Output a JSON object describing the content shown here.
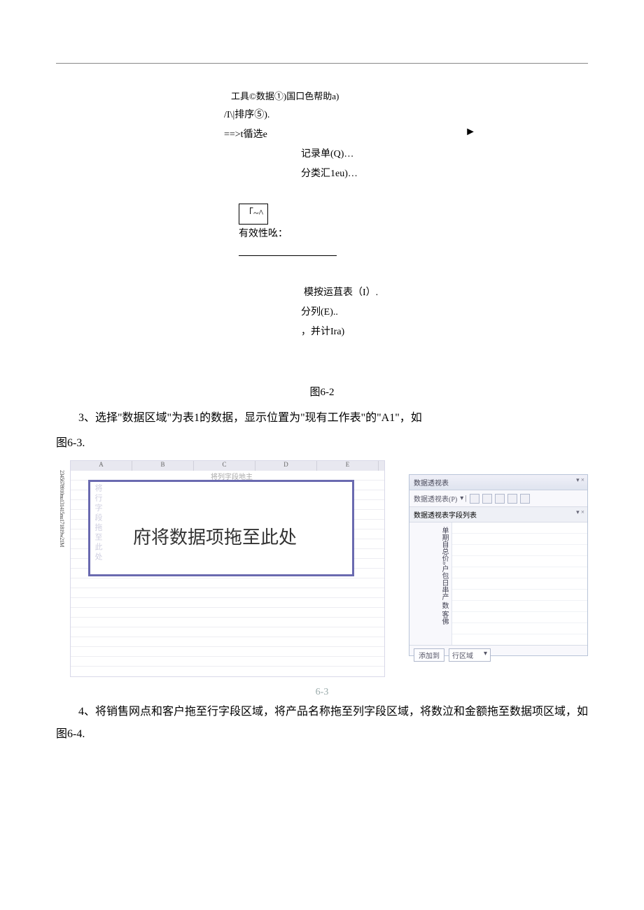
{
  "menu": {
    "title": "工具©数据①)国口色帮助a)",
    "sort": "/I\\|排序⑤).",
    "filter": "==>t循选e",
    "arrow": "►",
    "record": "记录单(Q)…",
    "subtotal": "分类汇1eu)…",
    "boxed": "「~^",
    "validity": "有效性吆：",
    "simtable": "模按运苴表（I）.",
    "texttocol": "分列(E)..",
    "calc": "，并计Ira)"
  },
  "captions": {
    "fig62": "图6-2",
    "fig63": "6-3"
  },
  "paragraphs": {
    "p3a": "3、选择\"数据区域\"为表1的数据，显示位置为\"现有工作表\"的\"A1\"，如",
    "p3b": "图6-3.",
    "p4": "4、将销售网点和客户拖至行字段区域，将产品名称拖至列字段区域，将数泣和金额拖至数据项区域，如图6-4."
  },
  "excel": {
    "cols": [
      "A",
      "B",
      "C",
      "D",
      "E"
    ],
    "drop_col": "将列字段地主",
    "row_nums": "2345678910nu131415nu171819w21M",
    "row_field_ghost": "将行字段拖至此处",
    "center": "府将数据项拖至此处"
  },
  "panel": {
    "title1": "数据透视表",
    "title2": "数据透视表(P)",
    "title3": "数据透视表字段列表",
    "vx": "▾ ×",
    "fields": "单期自总价»户包日串产\n数    客佛",
    "add_button": "添加到",
    "select_label": "行区域",
    "chev": "▾"
  }
}
